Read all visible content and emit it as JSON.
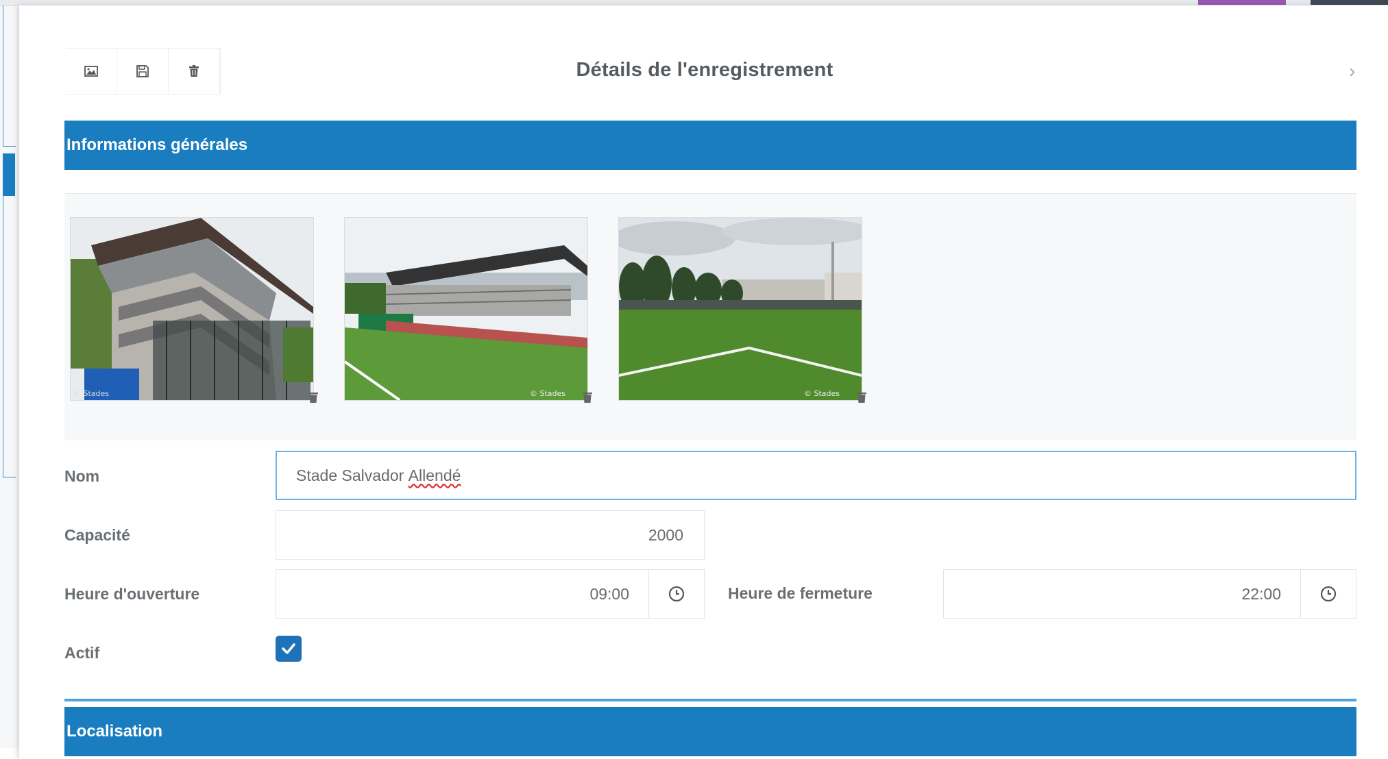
{
  "modal": {
    "title": "Détails de l'enregistrement",
    "close_glyph": "›"
  },
  "toolbar": {
    "buttons": [
      {
        "name": "image-button",
        "icon": "image-icon"
      },
      {
        "name": "save-button",
        "icon": "floppy-disk-icon"
      },
      {
        "name": "delete-button",
        "icon": "trash-icon"
      }
    ]
  },
  "sections": {
    "general": "Informations générales",
    "location": "Localisation"
  },
  "gallery": {
    "photos": [
      {
        "name": "photo-1",
        "watermark": "© Stades"
      },
      {
        "name": "photo-2",
        "watermark": "© Stades"
      },
      {
        "name": "photo-3",
        "watermark": "© Stades"
      }
    ],
    "delete_icon": "trash-icon"
  },
  "form": {
    "nom_label": "Nom",
    "nom_value_start": "Stade Salvador ",
    "nom_value_spell": "Allendé",
    "capacite_label": "Capacité",
    "capacite_value": "2000",
    "ouverture_label": "Heure d'ouverture",
    "ouverture_value": "09:00",
    "fermeture_label": "Heure de fermeture",
    "fermeture_value": "22:00",
    "actif_label": "Actif",
    "actif_checked": true
  },
  "colors": {
    "section_blue": "#1a7dc0",
    "checkbox_blue": "#1e72b8",
    "input_focus": "#6fb2e4"
  }
}
